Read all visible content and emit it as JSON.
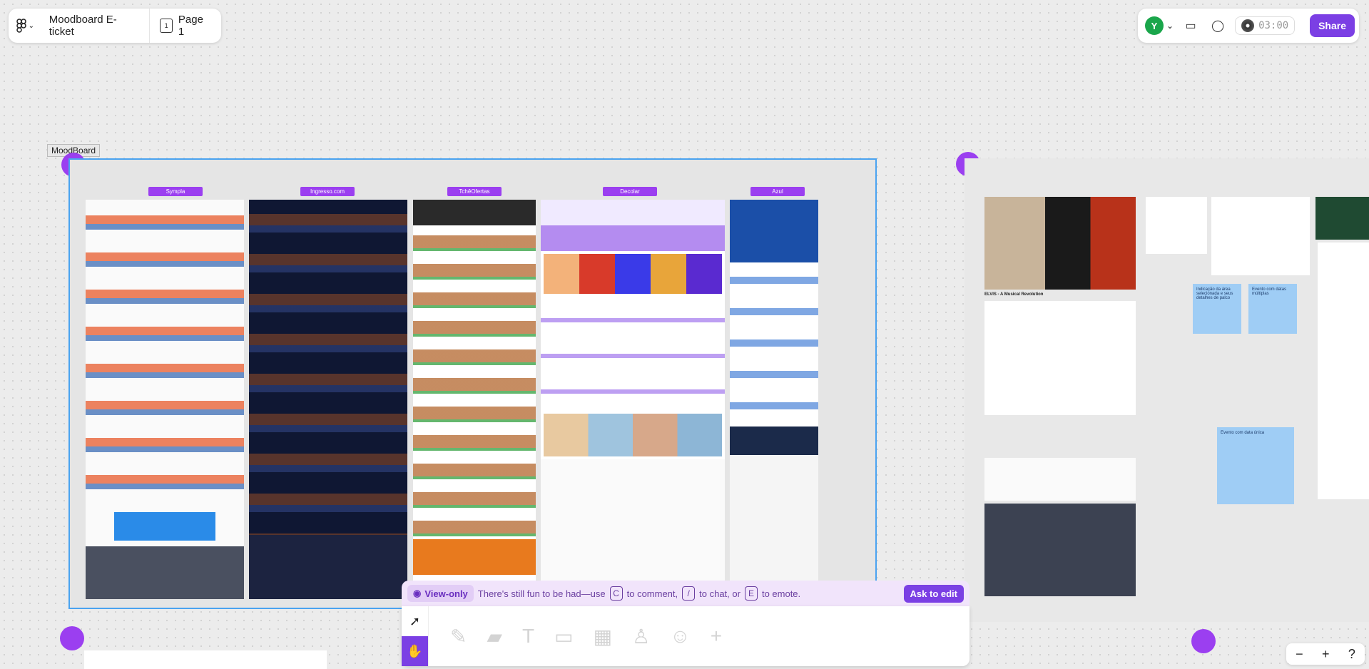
{
  "file": {
    "name": "Moodboard E-ticket",
    "page": "Page 1",
    "page_number": "1"
  },
  "header_right": {
    "avatar_initial": "Y",
    "timer": "03:00",
    "share_label": "Share",
    "colors": {
      "accent": "#7b3fe4",
      "avatar": "#1aa64b"
    }
  },
  "canvas": {
    "moodboard_label": "MoodBoard",
    "sites": [
      {
        "name": "Sympla",
        "shot_theme": "light"
      },
      {
        "name": "Ingresso.com",
        "shot_theme": "dark"
      },
      {
        "name": "TchêOfertas",
        "shot_theme": "orange"
      },
      {
        "name": "Decolar",
        "shot_theme": "purple"
      },
      {
        "name": "Azul",
        "shot_theme": "blue"
      }
    ],
    "stickies": [
      "Indicação da área selecionada e seus detalhes de palco",
      "Evento com datas múltiplas",
      "Evento com data única"
    ],
    "right_event_title": "ELVIS - A Musical Revolution"
  },
  "view_bar": {
    "mode": "View-only",
    "msg1": "There's still fun to be had—use",
    "key_comment": "C",
    "msg2": "to comment,",
    "key_chat": "/",
    "msg3": "to chat, or",
    "key_emote": "E",
    "msg4": "to emote.",
    "ask_label": "Ask to edit"
  },
  "zoom": {
    "minus": "−",
    "plus": "+",
    "help": "?"
  }
}
